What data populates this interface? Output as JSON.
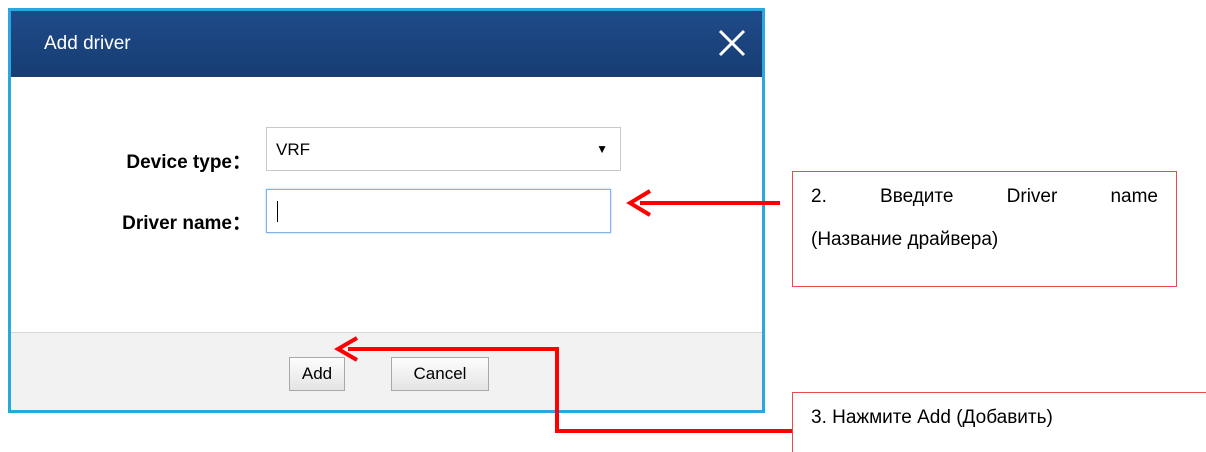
{
  "dialog": {
    "title": "Add driver",
    "close_icon": "close-icon",
    "device_type_label": "Device type：",
    "device_type_value": "VRF",
    "driver_name_label": "Driver name：",
    "driver_name_value": "",
    "add_label": "Add",
    "cancel_label": "Cancel"
  },
  "annotations": {
    "step2_words": [
      "2.",
      "Введите",
      "Driver",
      "name"
    ],
    "step2_line2": "(Название драйвера)",
    "step3": "3. Нажмите Add (Добавить)"
  },
  "colors": {
    "titlebar": "#1a4580",
    "dialog_border": "#29a8e0",
    "arrow": "#ff0000"
  }
}
